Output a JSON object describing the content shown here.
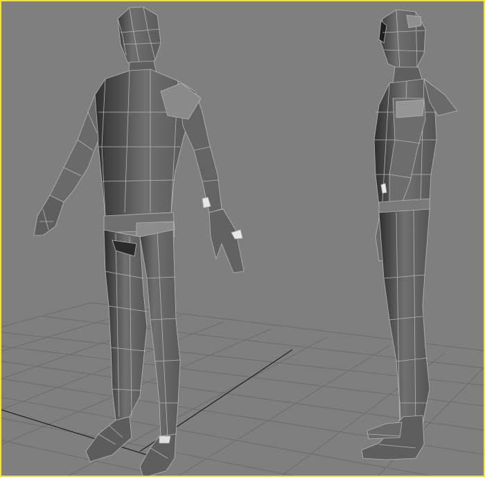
{
  "viewport": {
    "label": "",
    "background": "#7f7f7f",
    "border_color": "#f2e23a",
    "grid_color": "#6c6c6c",
    "axis_color": "#1f1f1f",
    "mesh_fill": "#6a6a6a",
    "mesh_wire": "#b7b7b7"
  },
  "scene": {
    "objects": [
      "character-front-view",
      "character-side-view"
    ]
  }
}
